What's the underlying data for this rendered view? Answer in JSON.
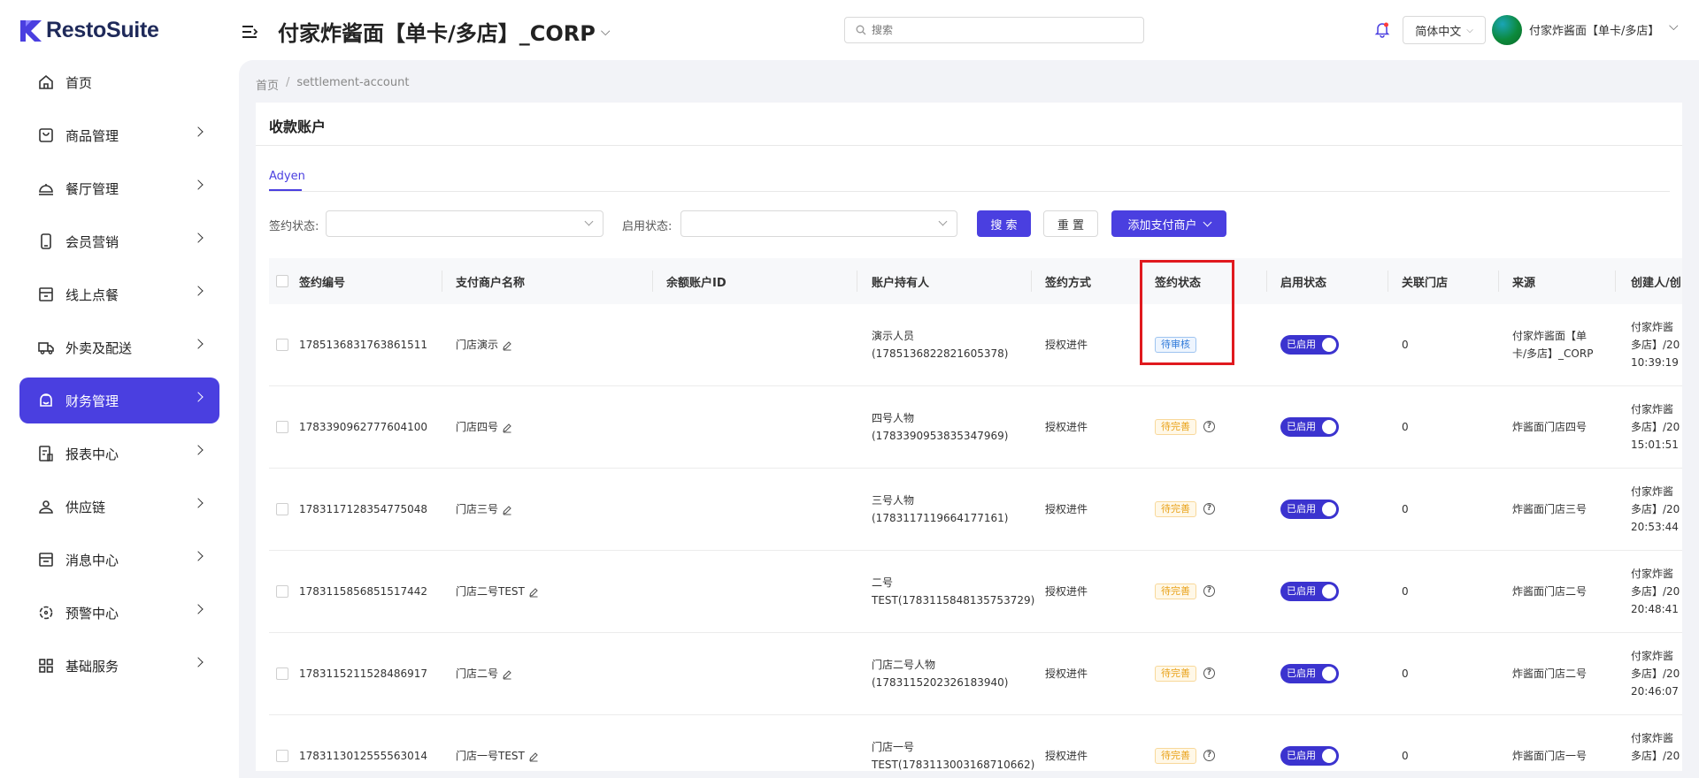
{
  "header": {
    "logo_text": "RestoSuite",
    "store_title": "付家炸酱面【单卡/多店】_CORP",
    "search_placeholder": "搜索",
    "language": "简体中文",
    "user_name": "付家炸酱面【单卡/多店】"
  },
  "sidebar": {
    "items": [
      {
        "label": "首页",
        "icon": "home-icon",
        "active": false,
        "has_arrow": false
      },
      {
        "label": "商品管理",
        "icon": "bag-icon",
        "active": false,
        "has_arrow": true
      },
      {
        "label": "餐厅管理",
        "icon": "cloche-icon",
        "active": false,
        "has_arrow": true
      },
      {
        "label": "会员营销",
        "icon": "phone-icon",
        "active": false,
        "has_arrow": true
      },
      {
        "label": "线上点餐",
        "icon": "store-icon",
        "active": false,
        "has_arrow": true
      },
      {
        "label": "外卖及配送",
        "icon": "truck-icon",
        "active": false,
        "has_arrow": true
      },
      {
        "label": "财务管理",
        "icon": "wallet-icon",
        "active": true,
        "has_arrow": true
      },
      {
        "label": "报表中心",
        "icon": "report-icon",
        "active": false,
        "has_arrow": true
      },
      {
        "label": "供应链",
        "icon": "supply-icon",
        "active": false,
        "has_arrow": true
      },
      {
        "label": "消息中心",
        "icon": "message-icon",
        "active": false,
        "has_arrow": true
      },
      {
        "label": "预警中心",
        "icon": "alert-icon",
        "active": false,
        "has_arrow": true
      },
      {
        "label": "基础服务",
        "icon": "grid-icon",
        "active": false,
        "has_arrow": true
      }
    ]
  },
  "breadcrumb": {
    "home": "首页",
    "separator": "/",
    "current": "settlement-account"
  },
  "page": {
    "title": "收款账户",
    "tab": "Adyen",
    "filters": {
      "sign_status_label": "签约状态:",
      "enable_status_label": "启用状态:",
      "search_button": "搜 索",
      "reset_button": "重 置",
      "add_button": "添加支付商户"
    }
  },
  "table": {
    "columns": [
      "签约编号",
      "支付商户名称",
      "余额账户ID",
      "账户持有人",
      "签约方式",
      "签约状态",
      "启用状态",
      "关联门店",
      "来源",
      "创建人/创"
    ],
    "rows": [
      {
        "id": "1785136831763861511",
        "merchant": "门店演示",
        "balance_id": "",
        "holder_line1": "演示人员",
        "holder_line2": "(1785136822821605378)",
        "method": "授权进件",
        "status": "待审核",
        "status_type": "blue",
        "has_help": false,
        "enabled": "已启用",
        "stores": "0",
        "source_line1": "付家炸酱面【单",
        "source_line2": "卡/多店】_CORP",
        "creator_line1": "付家炸酱",
        "creator_line2": "多店】/20",
        "creator_line3": "10:39:19"
      },
      {
        "id": "1783390962777604100",
        "merchant": "门店四号",
        "balance_id": "",
        "holder_line1": "四号人物",
        "holder_line2": "(1783390953835347969)",
        "method": "授权进件",
        "status": "待完善",
        "status_type": "orange",
        "has_help": true,
        "enabled": "已启用",
        "stores": "0",
        "source_line1": "炸酱面门店四号",
        "source_line2": "",
        "creator_line1": "付家炸酱",
        "creator_line2": "多店】/20",
        "creator_line3": "15:01:51"
      },
      {
        "id": "1783117128354775048",
        "merchant": "门店三号",
        "balance_id": "",
        "holder_line1": "三号人物",
        "holder_line2": "(1783117119664177161)",
        "method": "授权进件",
        "status": "待完善",
        "status_type": "orange",
        "has_help": true,
        "enabled": "已启用",
        "stores": "0",
        "source_line1": "炸酱面门店三号",
        "source_line2": "",
        "creator_line1": "付家炸酱",
        "creator_line2": "多店】/20",
        "creator_line3": "20:53:44"
      },
      {
        "id": "1783115856851517442",
        "merchant": "门店二号TEST",
        "balance_id": "",
        "holder_line1": "二号",
        "holder_line2": "TEST(1783115848135753729)",
        "method": "授权进件",
        "status": "待完善",
        "status_type": "orange",
        "has_help": true,
        "enabled": "已启用",
        "stores": "0",
        "source_line1": "炸酱面门店二号",
        "source_line2": "",
        "creator_line1": "付家炸酱",
        "creator_line2": "多店】/20",
        "creator_line3": "20:48:41"
      },
      {
        "id": "1783115211528486917",
        "merchant": "门店二号",
        "balance_id": "",
        "holder_line1": "门店二号人物",
        "holder_line2": "(1783115202326183940)",
        "method": "授权进件",
        "status": "待完善",
        "status_type": "orange",
        "has_help": true,
        "enabled": "已启用",
        "stores": "0",
        "source_line1": "炸酱面门店二号",
        "source_line2": "",
        "creator_line1": "付家炸酱",
        "creator_line2": "多店】/20",
        "creator_line3": "20:46:07"
      },
      {
        "id": "1783113012555563014",
        "merchant": "门店一号TEST",
        "balance_id": "",
        "holder_line1": "门店一号",
        "holder_line2": "TEST(1783113003168710662)",
        "method": "授权进件",
        "status": "待完善",
        "status_type": "orange",
        "has_help": true,
        "enabled": "已启用",
        "stores": "0",
        "source_line1": "炸酱面门店一号",
        "source_line2": "",
        "creator_line1": "付家炸酱",
        "creator_line2": "多店】/20",
        "creator_line3": ""
      }
    ]
  },
  "colors": {
    "accent": "#4a3fe0",
    "highlight": "#e0191e",
    "tag_blue": "#2f7ad9",
    "tag_orange": "#e9a21a"
  }
}
